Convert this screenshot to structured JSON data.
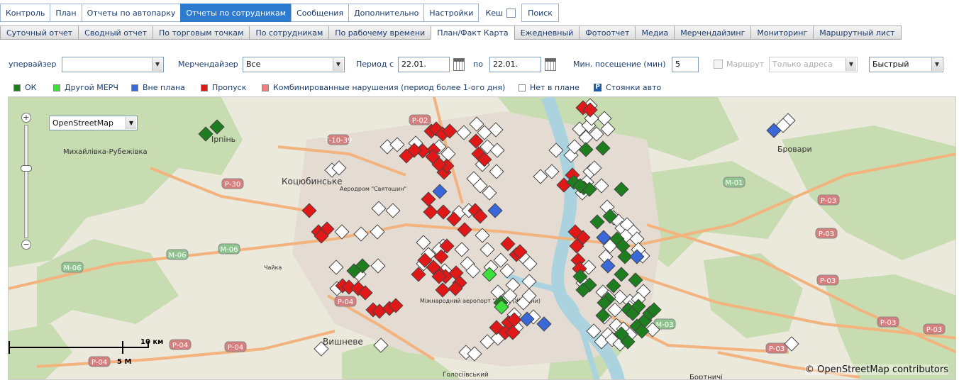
{
  "nav": {
    "tabs": [
      "Контроль",
      "План",
      "Отчеты по автопарку",
      "Отчеты по сотрудникам",
      "Сообщения",
      "Дополнительно",
      "Настройки"
    ],
    "active": 3,
    "kesh_label": "Кеш",
    "search_label": "Поиск"
  },
  "subnav": {
    "tabs": [
      "Суточный отчет",
      "Сводный отчет",
      "По торговым точкам",
      "По сотрудникам",
      "По рабочему времени",
      "План/Факт Карта",
      "Ежедневный",
      "Фотоотчет",
      "Медиа",
      "Мерчендайзинг",
      "Мониторинг",
      "Маршрутный лист"
    ],
    "active": 5
  },
  "filters": {
    "supervisor_label": "упервайзер",
    "supervisor_value": "",
    "merch_label": "Мерчендайзер",
    "merch_value": "Все",
    "period_from_label": "Период с",
    "period_from": "22.01.",
    "period_to_label": "по",
    "period_to": "22.01.",
    "min_visit_label": "Мин. посещение (мин)",
    "min_visit": "5",
    "route_label": "Маршрут",
    "route_value": "Только адреса",
    "speed_value": "Быстрый"
  },
  "legend": {
    "items": [
      {
        "label": "ОК",
        "color": "#1e7d1e"
      },
      {
        "label": "Другой МЕРЧ",
        "color": "#3de03d"
      },
      {
        "label": "Вне плана",
        "color": "#3a68d8"
      },
      {
        "label": "Пропуск",
        "color": "#e01818"
      },
      {
        "label": "Комбинированные нарушения (период более 1-ого дня)",
        "color": "#f08080"
      },
      {
        "label": "Нет в плане",
        "color": "#ffffff"
      },
      {
        "label": "Стоянки авто",
        "color": "#1b5fa8",
        "glyph": "P"
      }
    ]
  },
  "map": {
    "layer": "OpenStreetMap",
    "scale_km": "10 км",
    "scale_mi": "5 M",
    "attribution": "© OpenStreetMap contributors",
    "labels": [
      "Ірпінь",
      "Михайлівка-Рубежівка",
      "Коцюбинське",
      "Аеродром \"Святошин\"",
      "Чайка",
      "Міжнародний аеропорт \"Київ\" (Жуляни)",
      "Вишневе",
      "Бровари",
      "Бортничі",
      "Голосіївський"
    ],
    "roads": [
      "Р-02",
      "Т-10-39",
      "Р-30",
      "М-06",
      "Р-04",
      "М-01",
      "Р-03",
      "М-03"
    ],
    "marker_colors": {
      "ok": "#1e7d1e",
      "other": "#3de03d",
      "offplan": "#3a68d8",
      "miss": "#e01818",
      "notinplan": "#ffffff"
    }
  }
}
